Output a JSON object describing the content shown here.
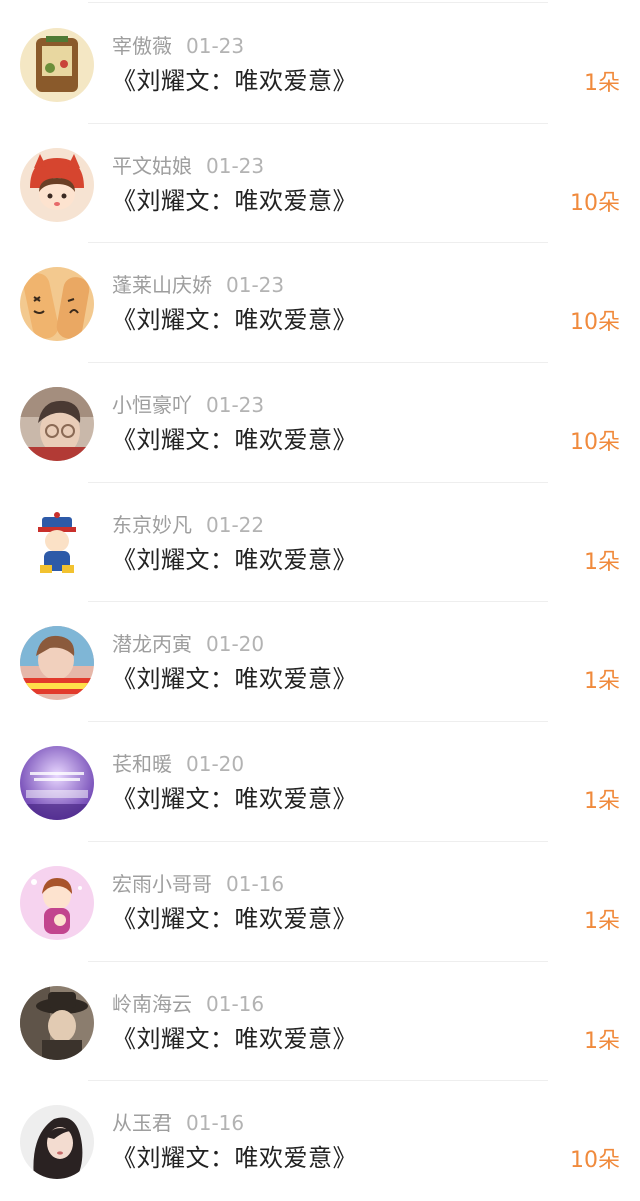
{
  "accent_color": "#f08a3c",
  "gifts": [
    {
      "name": "宰傲薇",
      "date": "01-23",
      "message": "《刘耀文：唯欢爱意》",
      "count": "1朵",
      "avatar_icon": "cartoon-book-avatar",
      "avatar_colors": [
        "#f4e7c4",
        "#8a5a2b"
      ]
    },
    {
      "name": "平文姑娘",
      "date": "01-23",
      "message": "《刘耀文：唯欢爱意》",
      "count": "10朵",
      "avatar_icon": "cartoon-girl-avatar",
      "avatar_colors": [
        "#f6e3d2",
        "#d6452f"
      ]
    },
    {
      "name": "蓬莱山庆娇",
      "date": "01-23",
      "message": "《刘耀文：唯欢爱意》",
      "count": "10朵",
      "avatar_icon": "fingers-face-avatar",
      "avatar_colors": [
        "#f3c98f",
        "#3a2a1c"
      ]
    },
    {
      "name": "小恒豪吖",
      "date": "01-23",
      "message": "《刘耀文：唯欢爱意》",
      "count": "10朵",
      "avatar_icon": "person-photo-avatar",
      "avatar_colors": [
        "#c9b8aa",
        "#4a3a33"
      ]
    },
    {
      "name": "东京妙凡",
      "date": "01-22",
      "message": "《刘耀文：唯欢爱意》",
      "count": "1朵",
      "avatar_icon": "cartoon-official-avatar",
      "avatar_colors": [
        "#ffffff",
        "#2d5aa8"
      ]
    },
    {
      "name": "潜龙丙寅",
      "date": "01-20",
      "message": "《刘耀文：唯欢爱意》",
      "count": "1朵",
      "avatar_icon": "person-banner-avatar",
      "avatar_colors": [
        "#e6b7a9",
        "#e23a2c"
      ]
    },
    {
      "name": "苌和暖",
      "date": "01-20",
      "message": "《刘耀文：唯欢爱意》",
      "count": "1朵",
      "avatar_icon": "purple-text-avatar",
      "avatar_colors": [
        "#8a5fc8",
        "#e9d8ff"
      ]
    },
    {
      "name": "宏雨小哥哥",
      "date": "01-16",
      "message": "《刘耀文：唯欢爱意》",
      "count": "1朵",
      "avatar_icon": "cartoon-boy-avatar",
      "avatar_colors": [
        "#f6d3ef",
        "#c2458e"
      ]
    },
    {
      "name": "岭南海云",
      "date": "01-16",
      "message": "《刘耀文：唯欢爱意》",
      "count": "1朵",
      "avatar_icon": "person-hat-avatar",
      "avatar_colors": [
        "#8b7d6e",
        "#2f2822"
      ]
    },
    {
      "name": "从玉君",
      "date": "01-16",
      "message": "《刘耀文：唯欢爱意》",
      "count": "10朵",
      "avatar_icon": "woman-photo-avatar",
      "avatar_colors": [
        "#eeeeee",
        "#2a2222"
      ]
    }
  ]
}
